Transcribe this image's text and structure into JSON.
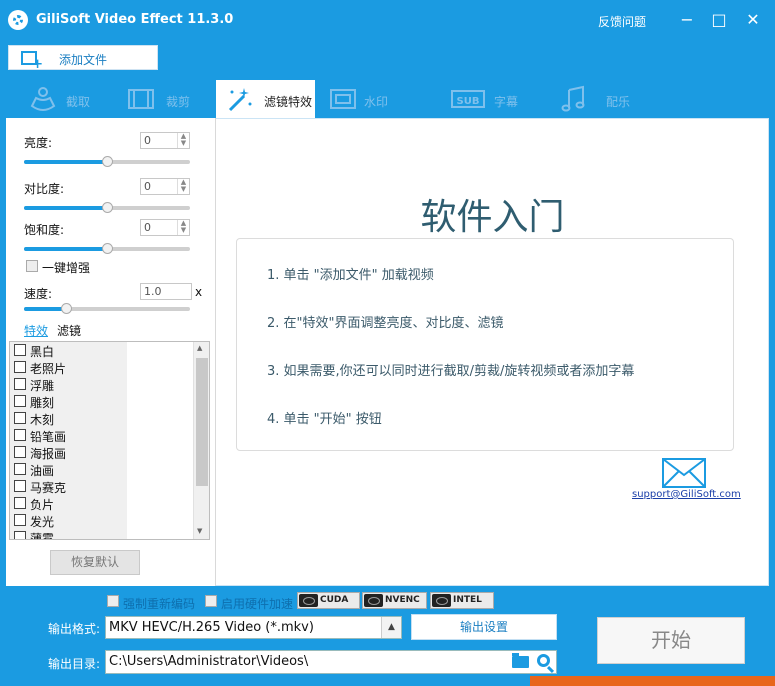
{
  "window": {
    "title": "GiliSoft Video Effect 11.3.0",
    "feedback": "反馈问题",
    "minimize": "−",
    "maximize": "□",
    "close": "✕"
  },
  "toolbar": {
    "add_file": "添加文件"
  },
  "tabs": [
    {
      "label": "截取",
      "icon": "genie-icon"
    },
    {
      "label": "裁剪",
      "icon": "film-crop-icon"
    },
    {
      "label": "滤镜特效",
      "icon": "magic-wand-icon",
      "active": true
    },
    {
      "label": "水印",
      "icon": "watermark-icon"
    },
    {
      "label": "字幕",
      "icon": "subtitle-icon"
    },
    {
      "label": "配乐",
      "icon": "music-note-icon"
    }
  ],
  "adjust": {
    "brightness": {
      "label": "亮度:",
      "value": "0",
      "level": 0.5
    },
    "contrast": {
      "label": "对比度:",
      "value": "0",
      "level": 0.5
    },
    "saturation": {
      "label": "饱和度:",
      "value": "0",
      "level": 0.5
    },
    "auto_enhance": "一键增强",
    "speed": {
      "label": "速度:",
      "value": "1.0",
      "unit": "x",
      "level": 0.25
    }
  },
  "filter_tabs": {
    "effects": "特效",
    "filters": "滤镜"
  },
  "effects": [
    "黑白",
    "老照片",
    "浮雕",
    "雕刻",
    "木刻",
    "铅笔画",
    "海报画",
    "油画",
    "马赛克",
    "负片",
    "发光",
    "薄雾"
  ],
  "reset_label": "恢复默认",
  "guide": {
    "title": "软件入门",
    "steps": [
      "1. 单击 \"添加文件\" 加载视频",
      "2. 在\"特效\"界面调整亮度、对比度、滤镜",
      "3. 如果需要,你还可以同时进行截取/剪裁/旋转视频或者添加字幕",
      "4. 单击 \"开始\" 按钮"
    ],
    "support": "support@GiliSoft.com"
  },
  "bottom": {
    "force_reencode": "强制重新编码",
    "hw_accel": "启用硬件加速",
    "gpu": [
      "CUDA",
      "NVENC",
      "INTEL"
    ],
    "format_label": "输出格式:",
    "format_value": "MKV HEVC/H.265 Video (*.mkv)",
    "settings_label": "输出设置",
    "dir_label": "输出目录:",
    "dir_value": "C:\\Users\\Administrator\\Videos\\",
    "start_label": "开始"
  },
  "colors": {
    "accent": "#1b9be1",
    "title_text": "#2f5d70",
    "link": "#1a3ea8"
  }
}
